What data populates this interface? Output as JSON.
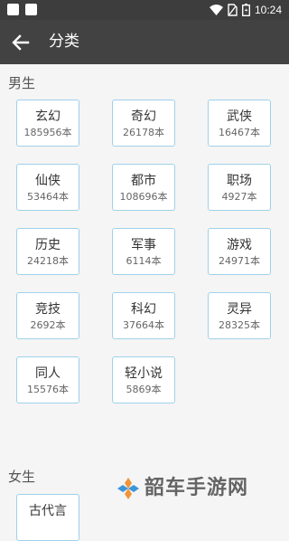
{
  "status_bar": {
    "time": "10:24",
    "icons": [
      "notification-icon",
      "notification-icon",
      "wifi-icon",
      "no-sim-icon",
      "battery-icon"
    ]
  },
  "app_bar": {
    "title": "分类",
    "back_icon": "arrow-left-icon"
  },
  "sections": {
    "male": {
      "title": "男生",
      "items": [
        {
          "name": "玄幻",
          "count": "185956本"
        },
        {
          "name": "奇幻",
          "count": "26178本"
        },
        {
          "name": "武侠",
          "count": "16467本"
        },
        {
          "name": "仙侠",
          "count": "53464本"
        },
        {
          "name": "都市",
          "count": "108696本"
        },
        {
          "name": "职场",
          "count": "4927本"
        },
        {
          "name": "历史",
          "count": "24218本"
        },
        {
          "name": "军事",
          "count": "6114本"
        },
        {
          "name": "游戏",
          "count": "24971本"
        },
        {
          "name": "竞技",
          "count": "2692本"
        },
        {
          "name": "科幻",
          "count": "37664本"
        },
        {
          "name": "灵异",
          "count": "28325本"
        },
        {
          "name": "同人",
          "count": "15576本"
        },
        {
          "name": "轻小说",
          "count": "5869本"
        }
      ]
    },
    "female": {
      "title": "女生",
      "items": [
        {
          "name": "古代言"
        }
      ]
    }
  },
  "watermark": {
    "text": "韶车手游网"
  },
  "colors": {
    "app_bar": "#424242",
    "status_bar": "#3d3d3d",
    "tile_border": "#9fd1ea",
    "background": "#f5f5f5",
    "watermark_orange": "#f08a24",
    "watermark_blue": "#2a8bd6"
  }
}
